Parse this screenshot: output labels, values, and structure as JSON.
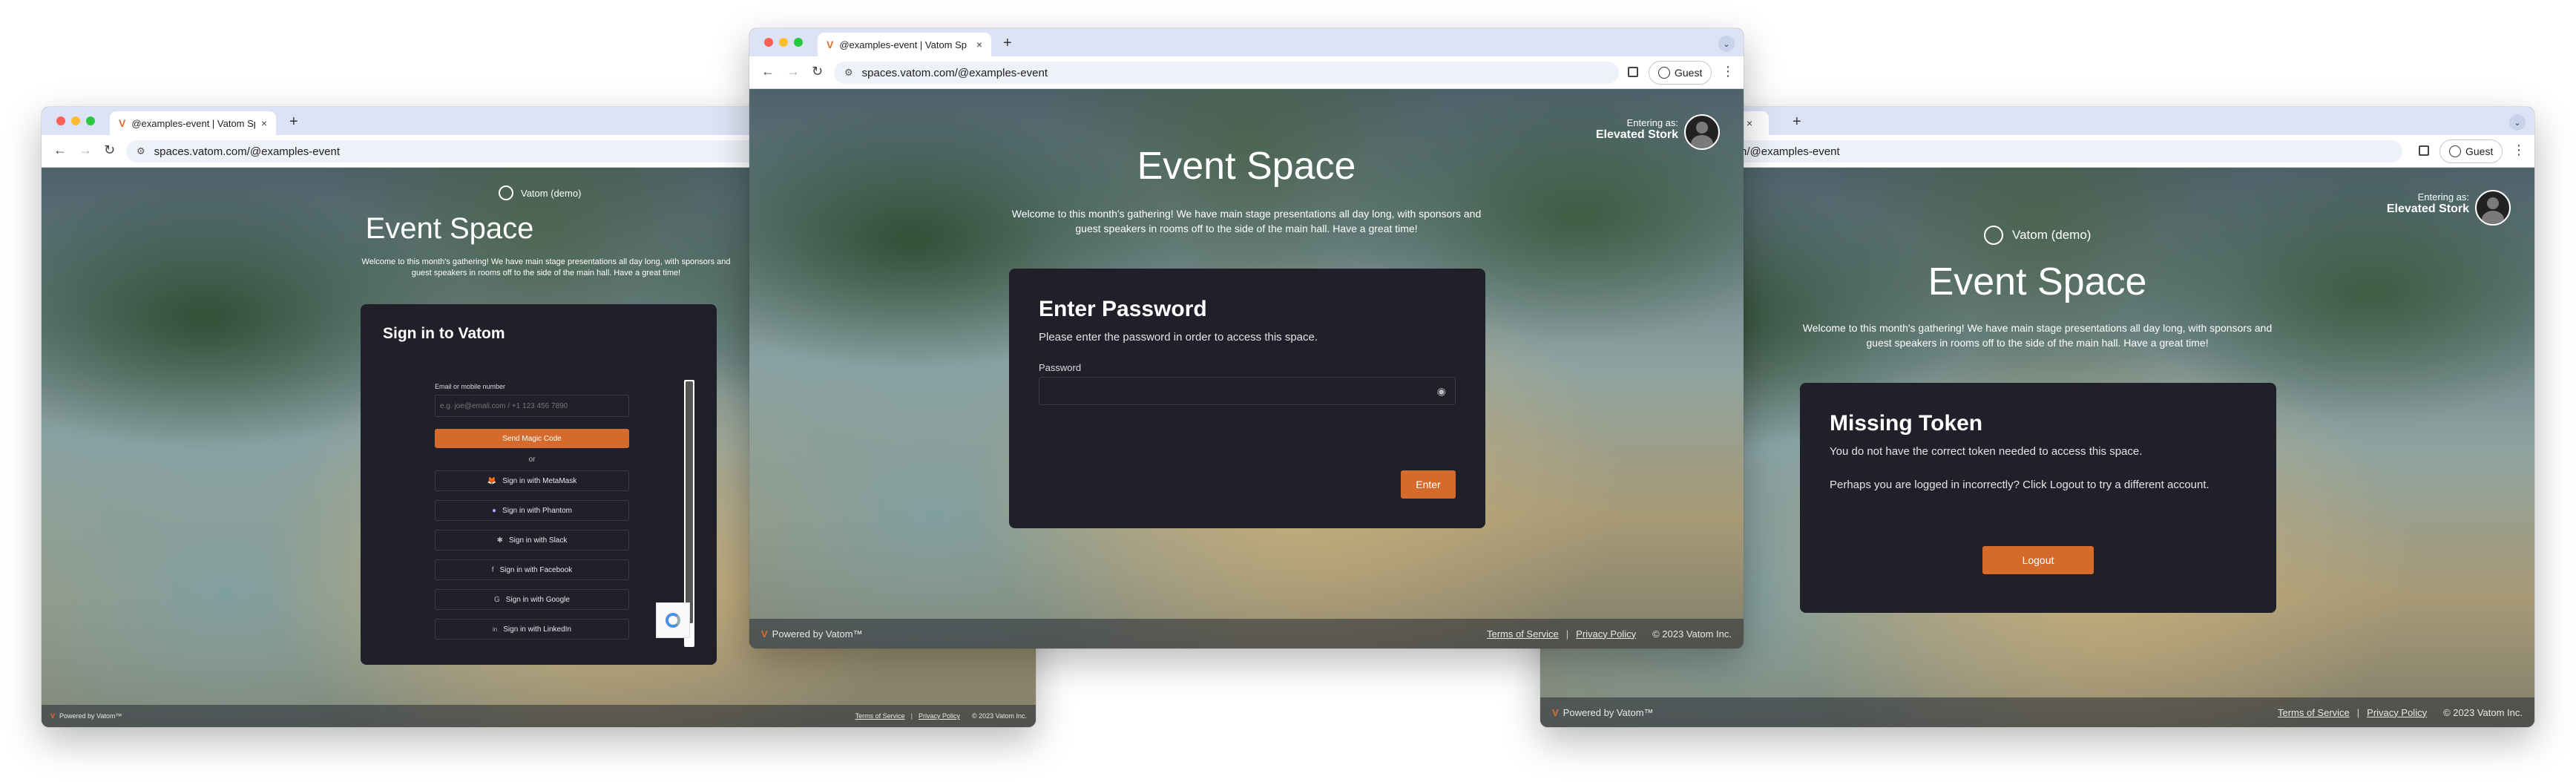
{
  "tab_title": "@examples-event | Vatom Sp",
  "tab_title_short": "@examples-event | Vatom Sp",
  "url": "spaces.vatom.com/@examples-event",
  "url_right_partial": "n/@examples-event",
  "guest_label": "Guest",
  "new_tab": "+",
  "close_tab": "×",
  "event": {
    "org_name": "Vatom (demo)",
    "title": "Event Space",
    "description": "Welcome to this month's gathering! We have main stage presentations all day long, with sponsors and guest speakers in rooms off to the side of the main hall. Have a great time!"
  },
  "entering": {
    "label": "Entering as:",
    "name": "Elevated Stork"
  },
  "signin": {
    "title": "Sign in to Vatom",
    "field_label": "Email or mobile number",
    "placeholder": "e.g. joe@email.com / +1 123 456 7890",
    "magic_button": "Send Magic Code",
    "or": "or",
    "providers": [
      {
        "label": "Sign in with MetaMask",
        "icon": "metamask-icon",
        "glyph": "🦊"
      },
      {
        "label": "Sign in with Phantom",
        "icon": "phantom-icon",
        "glyph": "●"
      },
      {
        "label": "Sign in with Slack",
        "icon": "slack-icon",
        "glyph": "✱"
      },
      {
        "label": "Sign in with Facebook",
        "icon": "facebook-icon",
        "glyph": "f"
      },
      {
        "label": "Sign in with Google",
        "icon": "google-icon",
        "glyph": "G"
      },
      {
        "label": "Sign in with LinkedIn",
        "icon": "linkedin-icon",
        "glyph": "in"
      }
    ]
  },
  "password": {
    "title": "Enter Password",
    "subtitle": "Please enter the password in order to access this space.",
    "label": "Password",
    "value": "",
    "enter_button": "Enter"
  },
  "missing_token": {
    "title": "Missing Token",
    "line1": "You do not have the correct token needed to access this space.",
    "line2": "Perhaps you are logged in incorrectly? Click Logout to try a different account.",
    "logout_button": "Logout"
  },
  "footer": {
    "powered": "Powered by Vatom™",
    "terms": "Terms of Service",
    "privacy": "Privacy Policy",
    "separator": "|",
    "copyright": "© 2023 Vatom Inc."
  },
  "colors": {
    "accent": "#d46b2c",
    "card": "#1f2029",
    "tabbar": "#dbe3f4"
  }
}
